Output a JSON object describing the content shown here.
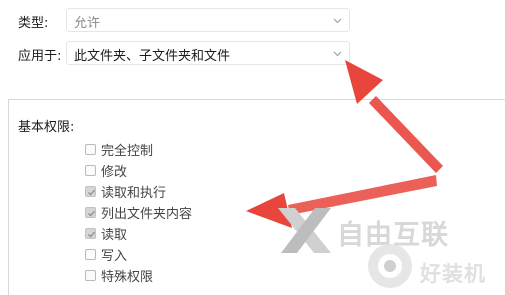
{
  "type_row": {
    "label": "类型:",
    "value": "允许"
  },
  "apply_row": {
    "label": "应用于:",
    "value": "此文件夹、子文件夹和文件"
  },
  "basic_permissions": {
    "title": "基本权限:",
    "items": [
      {
        "label": "完全控制",
        "checked": false
      },
      {
        "label": "修改",
        "checked": false
      },
      {
        "label": "读取和执行",
        "checked": true
      },
      {
        "label": "列出文件夹内容",
        "checked": true
      },
      {
        "label": "读取",
        "checked": true
      },
      {
        "label": "写入",
        "checked": false
      },
      {
        "label": "特殊权限",
        "checked": false
      }
    ]
  },
  "watermark": {
    "text": "自由互联",
    "badge_text": "好装机"
  },
  "colors": {
    "arrow": "#e8453c",
    "checkbox_checked": "#d6d6d6"
  }
}
